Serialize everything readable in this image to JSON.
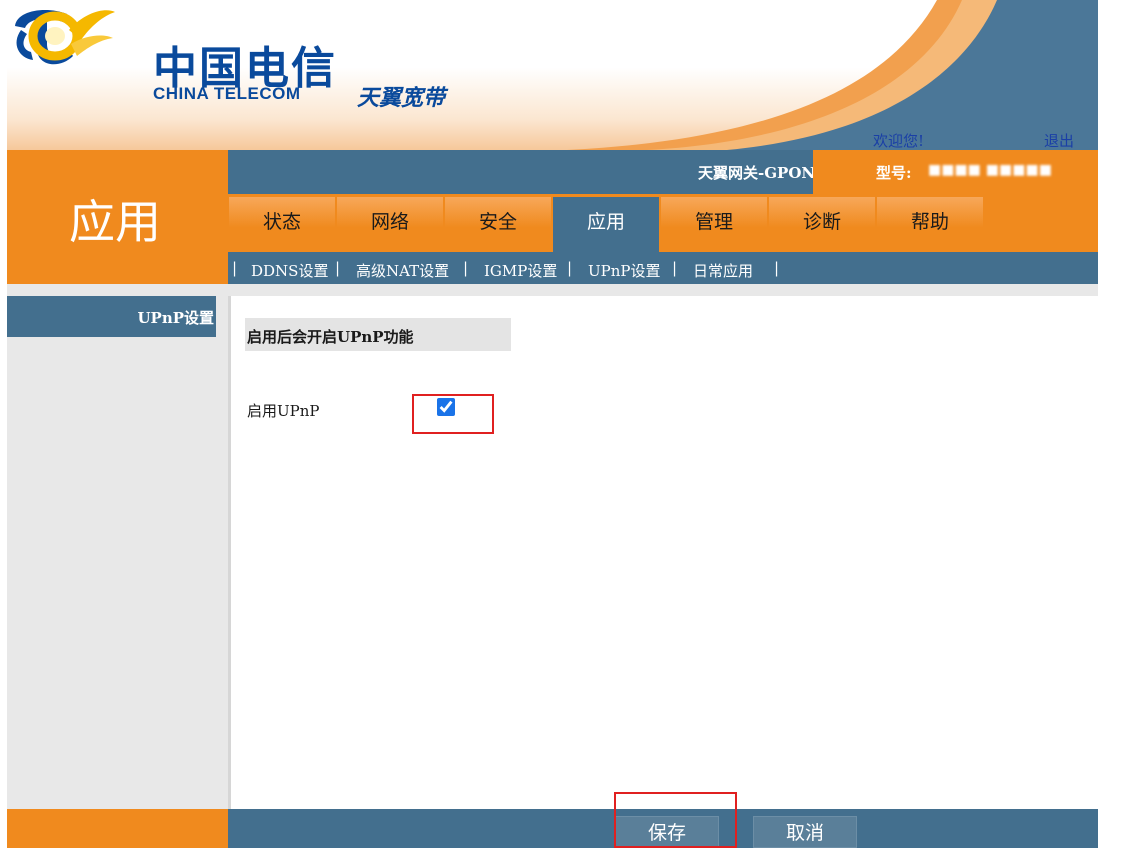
{
  "header": {
    "brand_cn": "中国电信",
    "brand_en": "CHINA TELECOM",
    "product": "天翼宽带",
    "welcome": "欢迎您!",
    "logout": "退出",
    "gateway_name": "天翼网关-GPON",
    "model_label": "型号:",
    "model_value": "■■■■ ■■■■■"
  },
  "section_title": "应用",
  "tabs": [
    {
      "label": "状态"
    },
    {
      "label": "网络"
    },
    {
      "label": "安全"
    },
    {
      "label": "应用"
    },
    {
      "label": "管理"
    },
    {
      "label": "诊断"
    },
    {
      "label": "帮助"
    }
  ],
  "active_tab": "应用",
  "sub_nav": [
    {
      "label": "DDNS设置"
    },
    {
      "label": "高级NAT设置"
    },
    {
      "label": "IGMP设置"
    },
    {
      "label": "UPnP设置"
    },
    {
      "label": "日常应用"
    }
  ],
  "sidebar": {
    "items": [
      {
        "label": "UPnP设置"
      }
    ]
  },
  "main": {
    "hint": "启用后会开启UPnP功能",
    "upnp_label": "启用UPnP",
    "upnp_enabled": true
  },
  "footer": {
    "save_label": "保存",
    "cancel_label": "取消"
  },
  "colors": {
    "orange": "#f08a1e",
    "blue": "#436f8e",
    "brand_blue": "#0a4a9c",
    "highlight_red": "#e02020"
  }
}
